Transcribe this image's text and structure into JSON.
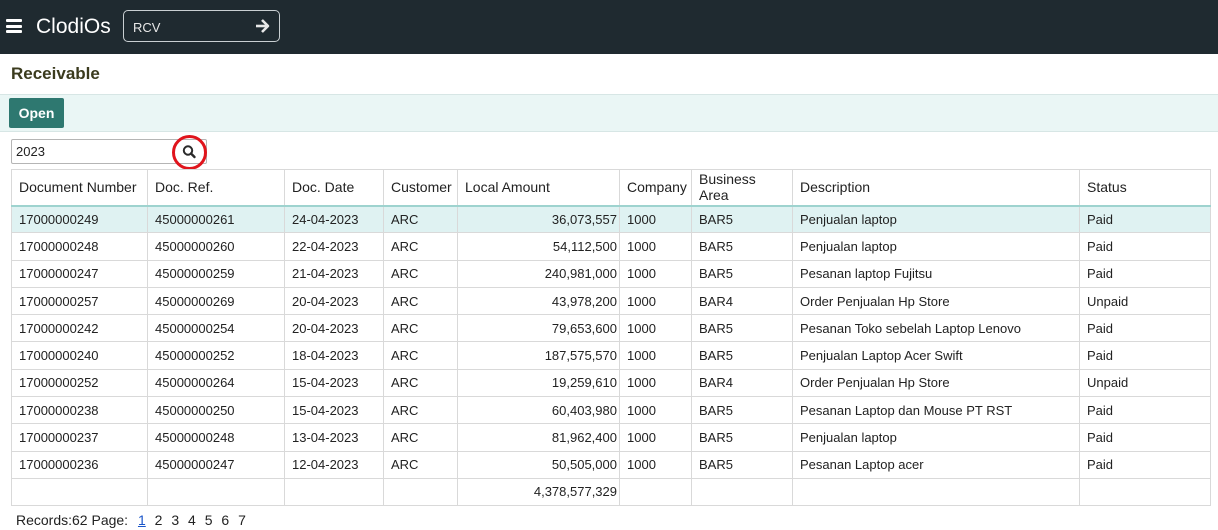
{
  "app": {
    "brand": "ClodiOs",
    "tcode_value": "RCV"
  },
  "page": {
    "title": "Receivable",
    "open_button": "Open",
    "filter_value": "2023"
  },
  "table": {
    "columns": [
      "Document Number",
      "Doc. Ref.",
      "Doc. Date",
      "Customer",
      "Local Amount",
      "Company",
      "Business Area",
      "Description",
      "Status"
    ],
    "rows": [
      [
        "17000000249",
        "45000000261",
        "24-04-2023",
        "ARC",
        "36,073,557",
        "1000",
        "BAR5",
        "Penjualan laptop",
        "Paid"
      ],
      [
        "17000000248",
        "45000000260",
        "22-04-2023",
        "ARC",
        "54,112,500",
        "1000",
        "BAR5",
        "Penjualan laptop",
        "Paid"
      ],
      [
        "17000000247",
        "45000000259",
        "21-04-2023",
        "ARC",
        "240,981,000",
        "1000",
        "BAR5",
        "Pesanan laptop Fujitsu",
        "Paid"
      ],
      [
        "17000000257",
        "45000000269",
        "20-04-2023",
        "ARC",
        "43,978,200",
        "1000",
        "BAR4",
        "Order Penjualan Hp Store",
        "Unpaid"
      ],
      [
        "17000000242",
        "45000000254",
        "20-04-2023",
        "ARC",
        "79,653,600",
        "1000",
        "BAR5",
        "Pesanan Toko sebelah Laptop Lenovo",
        "Paid"
      ],
      [
        "17000000240",
        "45000000252",
        "18-04-2023",
        "ARC",
        "187,575,570",
        "1000",
        "BAR5",
        "Penjualan Laptop Acer Swift",
        "Paid"
      ],
      [
        "17000000252",
        "45000000264",
        "15-04-2023",
        "ARC",
        "19,259,610",
        "1000",
        "BAR4",
        "Order Penjualan Hp Store",
        "Unpaid"
      ],
      [
        "17000000238",
        "45000000250",
        "15-04-2023",
        "ARC",
        "60,403,980",
        "1000",
        "BAR5",
        "Pesanan Laptop dan Mouse PT RST",
        "Paid"
      ],
      [
        "17000000237",
        "45000000248",
        "13-04-2023",
        "ARC",
        "81,962,400",
        "1000",
        "BAR5",
        "Penjualan laptop",
        "Paid"
      ],
      [
        "17000000236",
        "45000000247",
        "12-04-2023",
        "ARC",
        "50,505,000",
        "1000",
        "BAR5",
        "Pesanan Laptop acer",
        "Paid"
      ]
    ],
    "total_amount": "4,378,577,329"
  },
  "pager": {
    "records_label": "Records:62",
    "page_label": "Page:",
    "current_page": "1",
    "pages": [
      "2",
      "3",
      "4",
      "5",
      "6",
      "7"
    ]
  },
  "colors": {
    "topbar": "#1f2a30",
    "accent": "#2e7870",
    "selected_row": "#dff2f2",
    "highlight_ring": "#e0141c"
  }
}
